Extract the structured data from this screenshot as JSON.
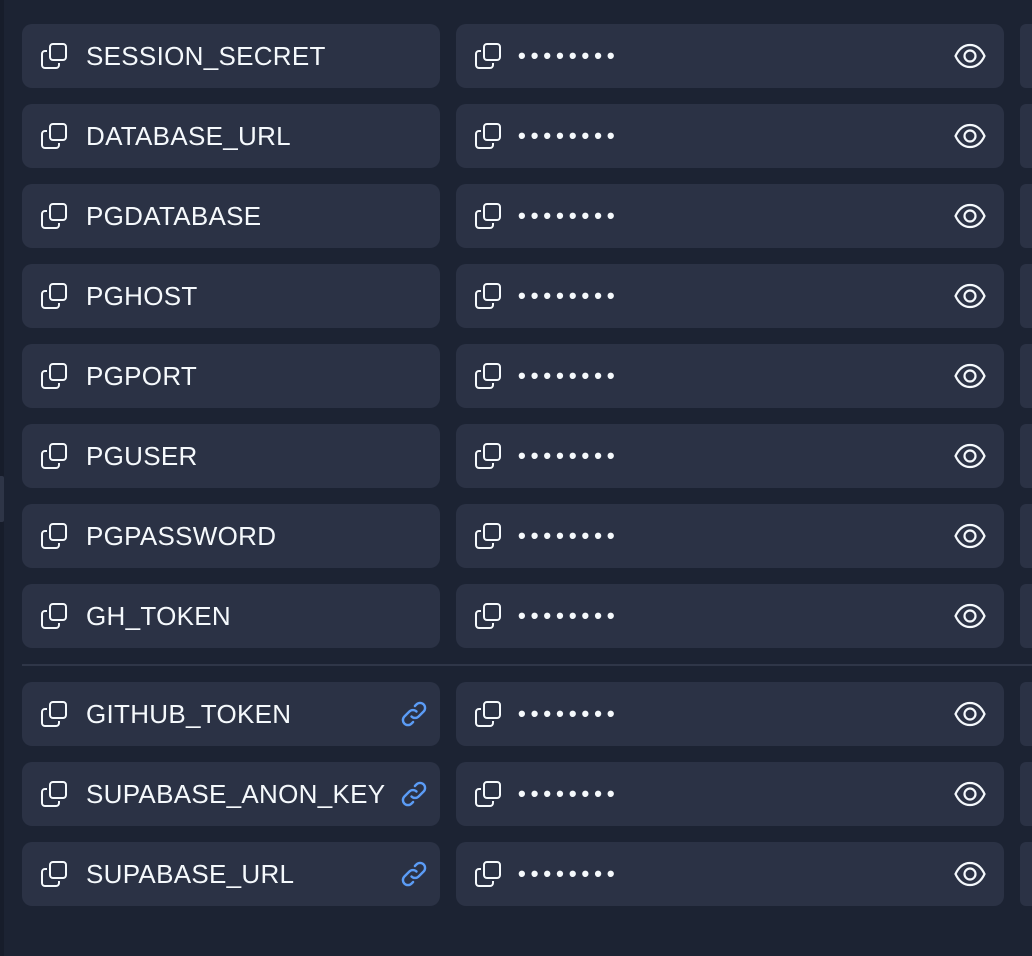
{
  "colors": {
    "background": "#1c2333",
    "cell": "#2b3245",
    "text": "#f5f9fc",
    "link_accent": "#5b9cf6",
    "divider": "#2f3648"
  },
  "icons": {
    "copy": "copy-icon",
    "reveal": "eye-icon",
    "linked": "link-icon"
  },
  "secrets": [
    {
      "key": "SESSION_SECRET",
      "value_masked": "••••••••",
      "linked": false
    },
    {
      "key": "DATABASE_URL",
      "value_masked": "••••••••",
      "linked": false
    },
    {
      "key": "PGDATABASE",
      "value_masked": "••••••••",
      "linked": false
    },
    {
      "key": "PGHOST",
      "value_masked": "••••••••",
      "linked": false
    },
    {
      "key": "PGPORT",
      "value_masked": "••••••••",
      "linked": false
    },
    {
      "key": "PGUSER",
      "value_masked": "••••••••",
      "linked": false
    },
    {
      "key": "PGPASSWORD",
      "value_masked": "••••••••",
      "linked": false
    },
    {
      "key": "GH_TOKEN",
      "value_masked": "••••••••",
      "linked": false
    }
  ],
  "linked_secrets": [
    {
      "key": "GITHUB_TOKEN",
      "value_masked": "••••••••",
      "linked": true
    },
    {
      "key": "SUPABASE_ANON_KEY",
      "value_masked": "••••••••",
      "linked": true
    },
    {
      "key": "SUPABASE_URL",
      "value_masked": "••••••••",
      "linked": true
    }
  ]
}
